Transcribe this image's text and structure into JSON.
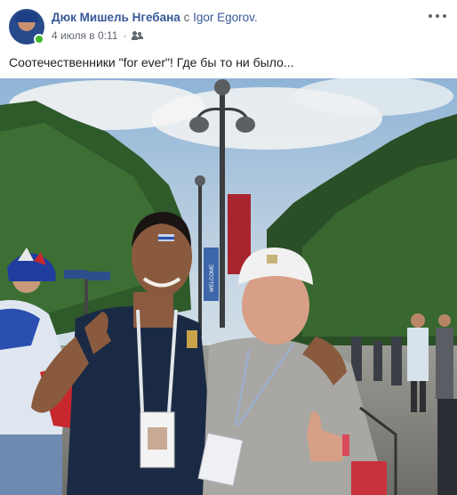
{
  "post": {
    "author": "Дюк Мишель Нгебана",
    "with_text": "с",
    "tagged": "Igor Egorov.",
    "timestamp": "4 июля в 0:11",
    "separator": "·",
    "audience_icon": "friends-icon",
    "more_icon": "more-options-icon",
    "text": "Соотечественники \"for ever\"! Где бы то ни было...",
    "photo": {
      "banner_text": "WELCOME",
      "badge_icon": "fifa-world-cup-emblem"
    }
  },
  "colors": {
    "link": "#385898",
    "secondary_text": "#616770",
    "online_status": "#42b72a"
  }
}
